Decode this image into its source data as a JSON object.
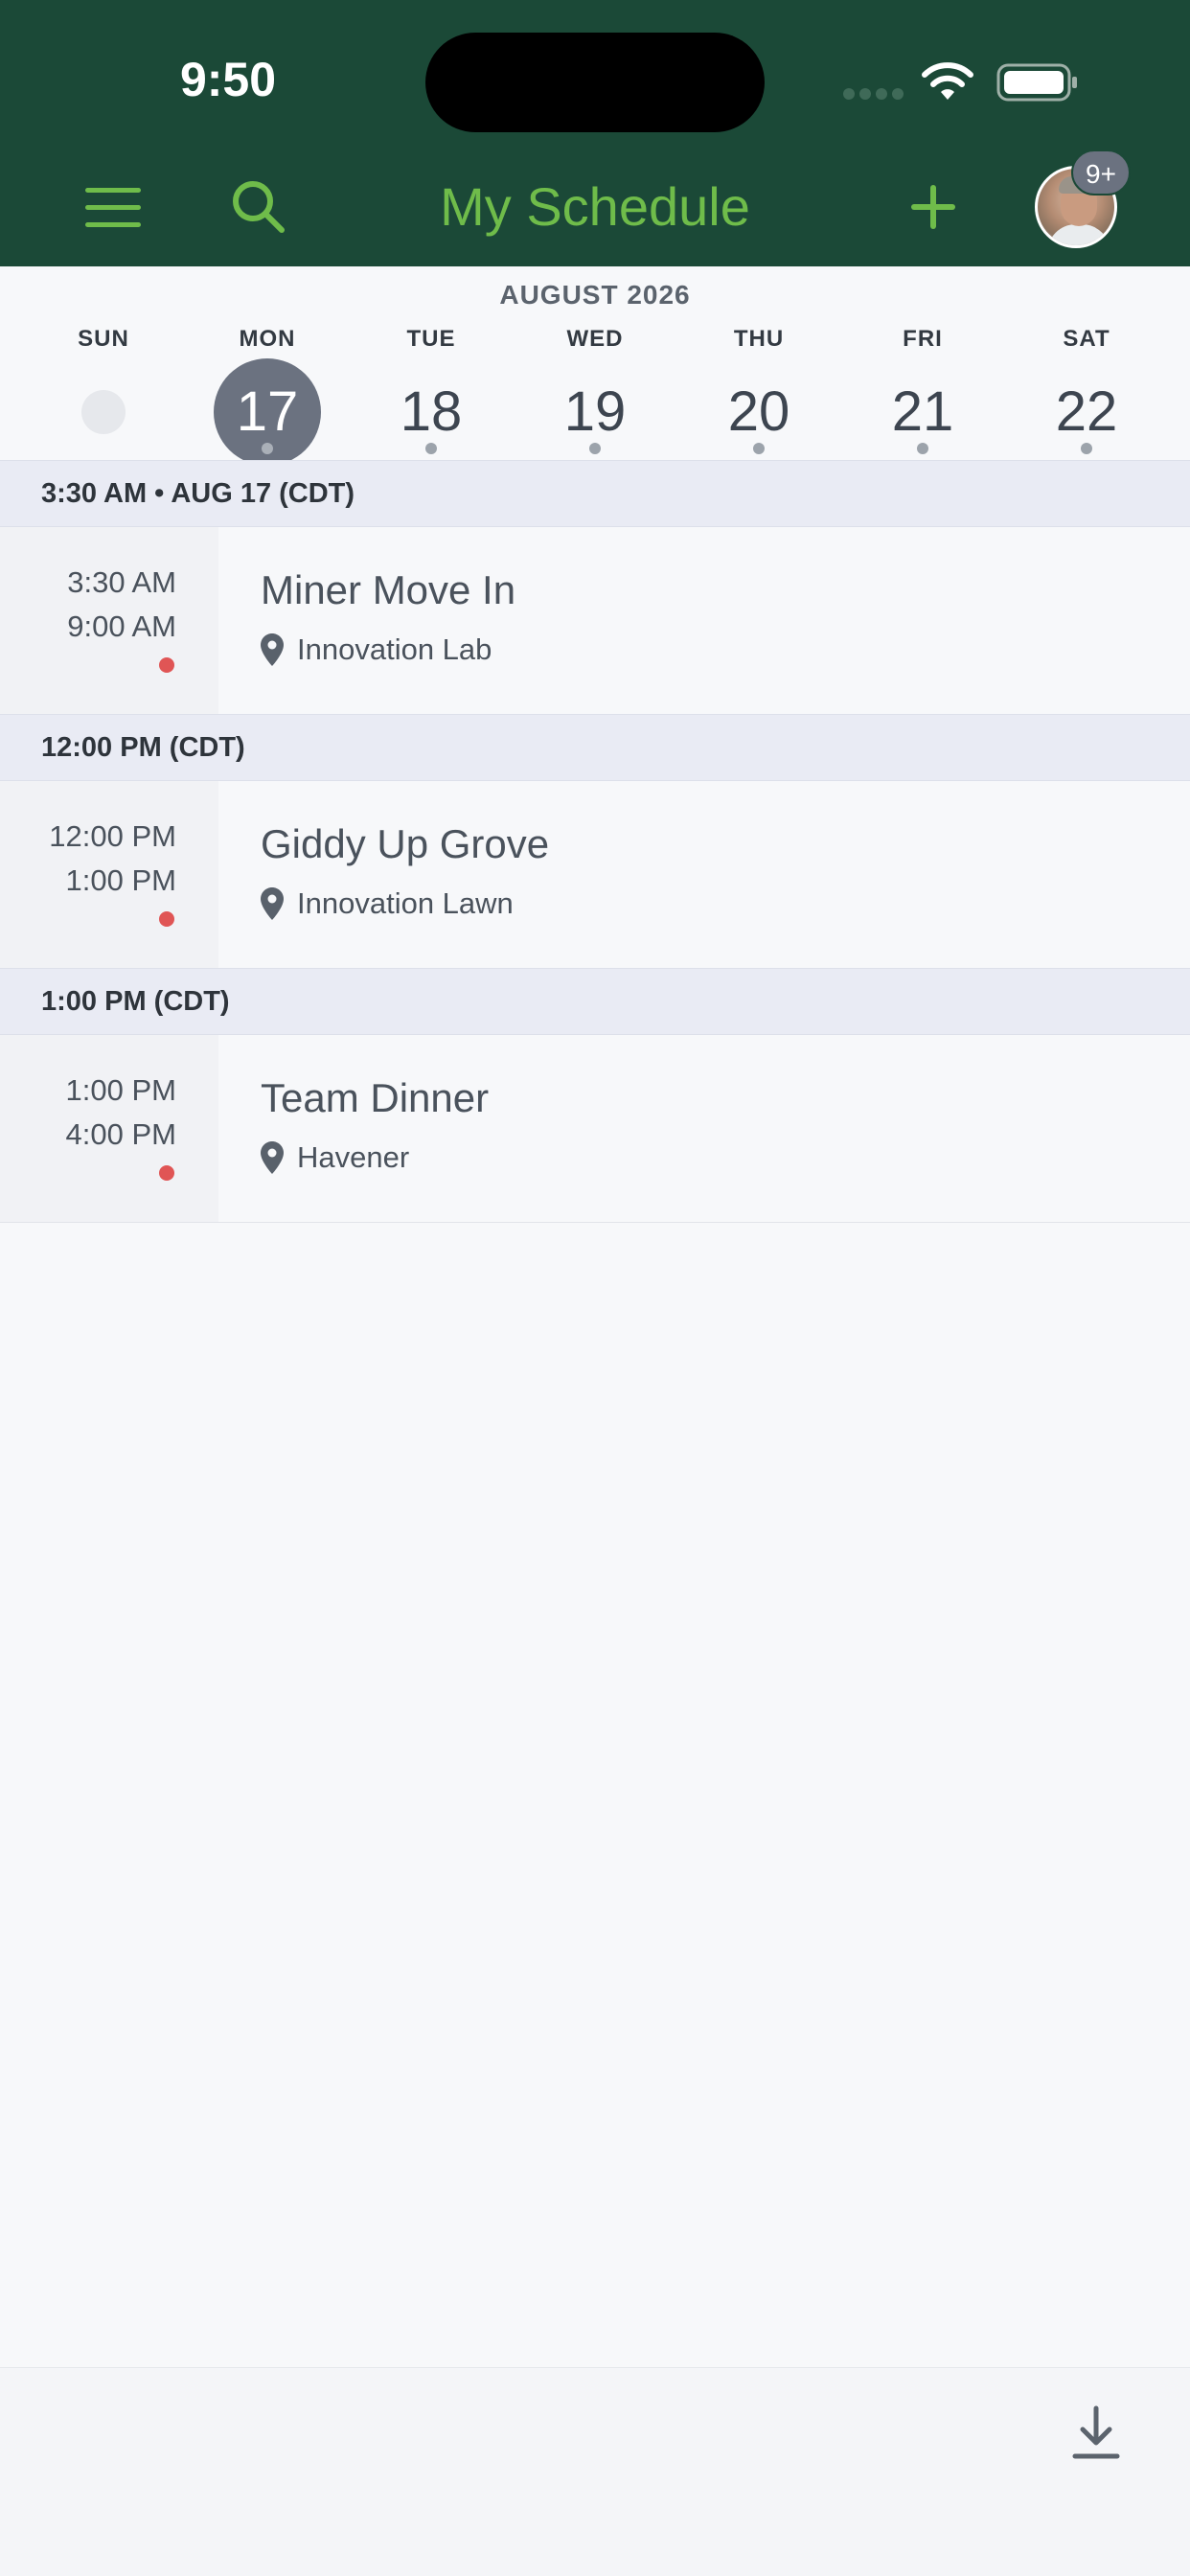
{
  "status_bar": {
    "time": "9:50"
  },
  "header": {
    "title": "My Schedule",
    "badge": "9+"
  },
  "week": {
    "month_label": "AUGUST 2026",
    "days": [
      {
        "dow": "SUN",
        "num": ""
      },
      {
        "dow": "MON",
        "num": "17"
      },
      {
        "dow": "TUE",
        "num": "18"
      },
      {
        "dow": "WED",
        "num": "19"
      },
      {
        "dow": "THU",
        "num": "20"
      },
      {
        "dow": "FRI",
        "num": "21"
      },
      {
        "dow": "SAT",
        "num": "22"
      }
    ]
  },
  "sections": [
    {
      "header": "3:30 AM • AUG 17 (CDT)",
      "event": {
        "start": "3:30 AM",
        "end": "9:00 AM",
        "title": "Miner Move In",
        "location": "Innovation Lab"
      }
    },
    {
      "header": "12:00 PM (CDT)",
      "event": {
        "start": "12:00 PM",
        "end": "1:00 PM",
        "title": "Giddy Up Grove",
        "location": "Innovation Lawn"
      }
    },
    {
      "header": "1:00 PM (CDT)",
      "event": {
        "start": "1:00 PM",
        "end": "4:00 PM",
        "title": "Team Dinner",
        "location": "Havener"
      }
    }
  ],
  "colors": {
    "header_bg": "#1b4937",
    "accent": "#6fbc4a",
    "selected_day": "#6b7280",
    "event_dot": "#e05555"
  }
}
